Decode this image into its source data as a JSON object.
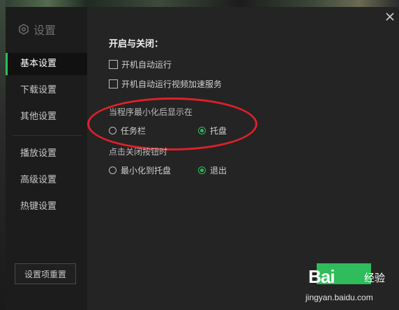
{
  "sidebar": {
    "brand_label": "设置",
    "items": [
      {
        "label": "基本设置",
        "active": true
      },
      {
        "label": "下载设置",
        "active": false
      },
      {
        "label": "其他设置",
        "active": false
      },
      {
        "label": "播放设置",
        "active": false
      },
      {
        "label": "高级设置",
        "active": false
      },
      {
        "label": "热键设置",
        "active": false
      }
    ],
    "reset_label": "设置项重置"
  },
  "main": {
    "section_title": "开启与关闭：",
    "checkboxes": [
      {
        "label": "开机自动运行",
        "checked": false
      },
      {
        "label": "开机自动运行视频加速服务",
        "checked": false
      }
    ],
    "minimize_group": {
      "label": "当程序最小化后显示在",
      "options": [
        {
          "label": "任务栏",
          "checked": false
        },
        {
          "label": "托盘",
          "checked": true
        }
      ]
    },
    "close_group": {
      "label": "点击关闭按钮时",
      "options": [
        {
          "label": "最小化到托盘",
          "checked": false
        },
        {
          "label": "退出",
          "checked": true
        }
      ]
    }
  },
  "watermark": {
    "brand": "Bai",
    "brand_suffix": "经验",
    "url": "jingyan.baidu.com"
  },
  "colors": {
    "accent": "#2ebd5a",
    "annotation": "#e0202a",
    "sidebar_bg": "#1c1c1c",
    "panel_bg": "#242424"
  }
}
